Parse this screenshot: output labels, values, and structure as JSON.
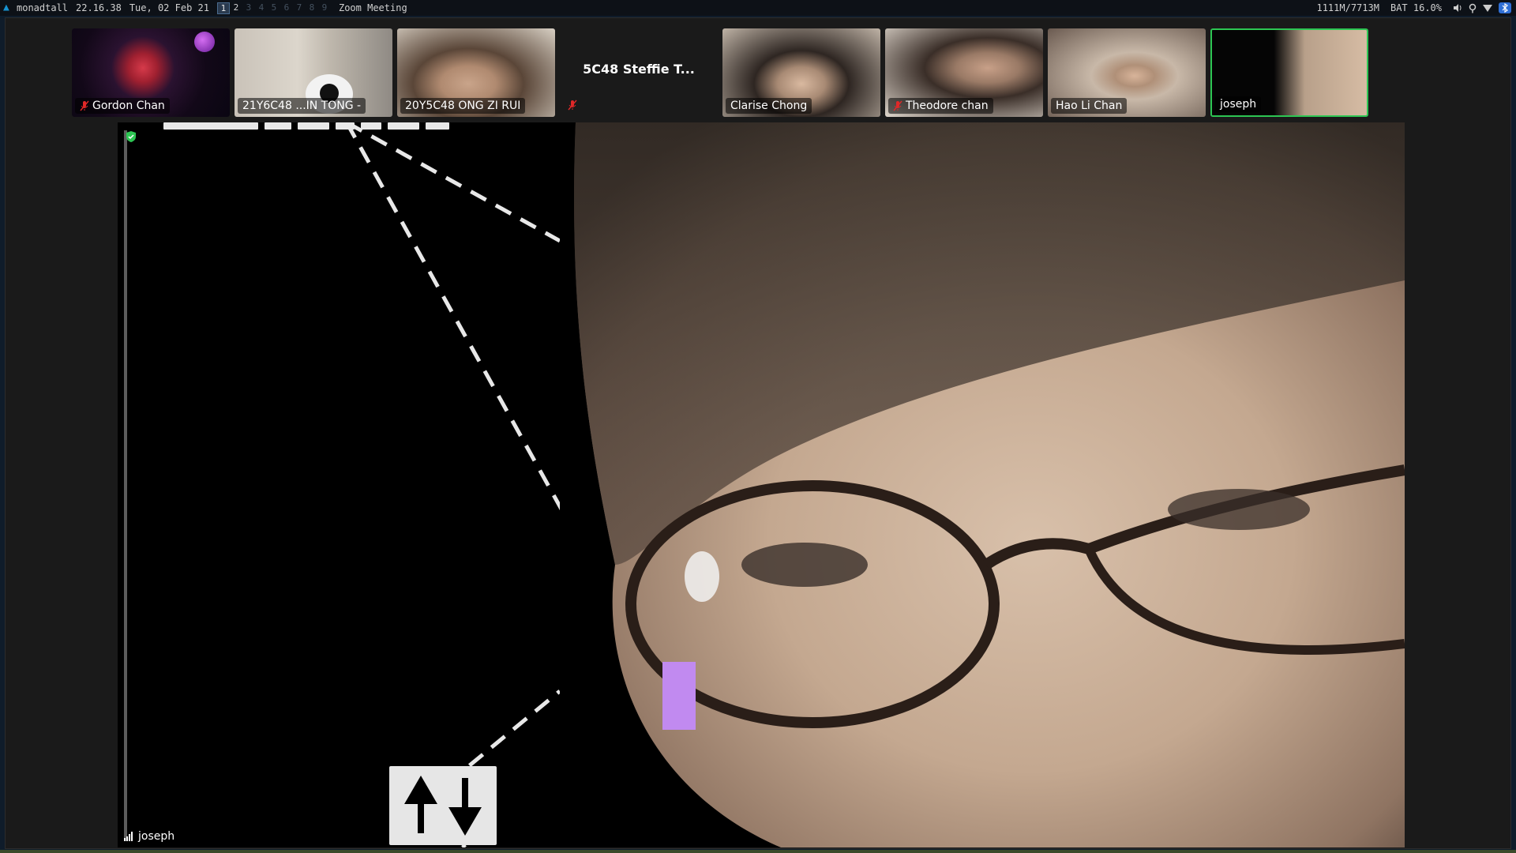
{
  "topbar": {
    "layout": "monadtall",
    "time": "22.16.38",
    "date": "Tue, 02 Feb 21",
    "workspaces": [
      "1",
      "2",
      "3",
      "4",
      "5",
      "6",
      "7",
      "8",
      "9"
    ],
    "active_workspace": "1",
    "window_title": "Zoom Meeting",
    "memory": "1111M/7713M",
    "battery": "BAT 16.0%",
    "tray_icons": [
      "volume-icon",
      "location-icon",
      "wifi-icon",
      "bluetooth-icon"
    ]
  },
  "meeting": {
    "participants": [
      {
        "name": "Gordon Chan",
        "muted": true,
        "video": true
      },
      {
        "name": "21Y6C48 ...IN TONG -",
        "muted": false,
        "video": true
      },
      {
        "name": "20Y5C48 ONG ZI RUI",
        "muted": false,
        "video": true
      },
      {
        "name": "5C48 Steffie T...",
        "muted": true,
        "video": false
      },
      {
        "name": "Clarise Chong",
        "muted": false,
        "video": true
      },
      {
        "name": "Theodore chan",
        "muted": true,
        "video": true
      },
      {
        "name": "Hao Li Chan",
        "muted": false,
        "video": true
      },
      {
        "name": "joseph",
        "muted": false,
        "video": true,
        "speaking": true
      }
    ],
    "active_speaker": "joseph",
    "colors": {
      "speaking_border": "#2dc653",
      "mute_red": "#e02828",
      "security_green": "#2dc653"
    }
  }
}
